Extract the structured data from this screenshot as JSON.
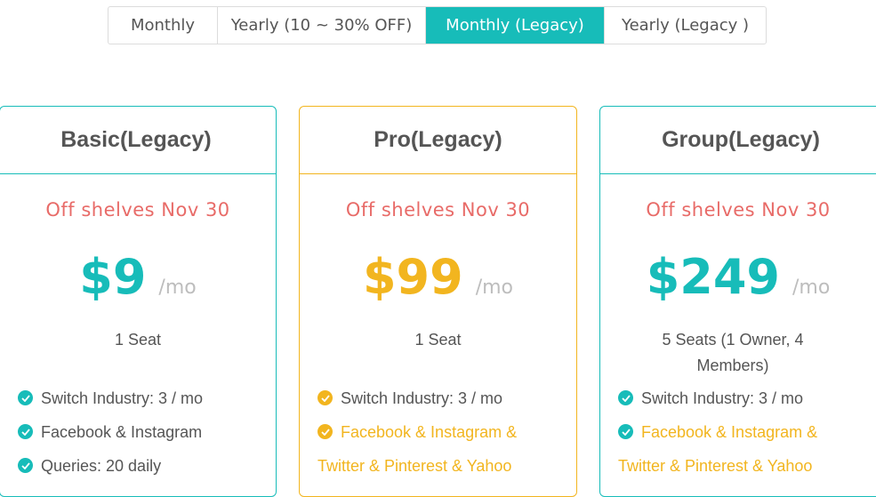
{
  "tabs": [
    {
      "label": "Monthly",
      "active": false
    },
    {
      "label": "Yearly (10 ~ 30% OFF)",
      "active": false
    },
    {
      "label": "Monthly (Legacy)",
      "active": true
    },
    {
      "label": "Yearly (Legacy )",
      "active": false
    }
  ],
  "colors": {
    "teal": "#17bcb9",
    "gold": "#f2b51f",
    "red": "#e86b68"
  },
  "plans": [
    {
      "name": "Basic(Legacy)",
      "notice": "Off shelves Nov 30",
      "price": "$9",
      "period": "/mo",
      "seats": "1 Seat",
      "features": [
        "Switch Industry: 3 / mo",
        "Facebook & Instagram",
        "Queries: 20 daily"
      ]
    },
    {
      "name": "Pro(Legacy)",
      "notice": "Off shelves Nov 30",
      "price": "$99",
      "period": "/mo",
      "seats": "1 Seat",
      "features": [
        "Switch Industry: 3 / mo",
        "Facebook & Instagram &",
        "Twitter & Pinterest & Yahoo"
      ]
    },
    {
      "name": "Group(Legacy)",
      "notice": "Off shelves Nov 30",
      "price": "$249",
      "period": "/mo",
      "seats": "5 Seats (1 Owner, 4 Members)",
      "features": [
        "Switch Industry: 3 / mo",
        "Facebook & Instagram &",
        "Twitter & Pinterest & Yahoo"
      ]
    }
  ]
}
